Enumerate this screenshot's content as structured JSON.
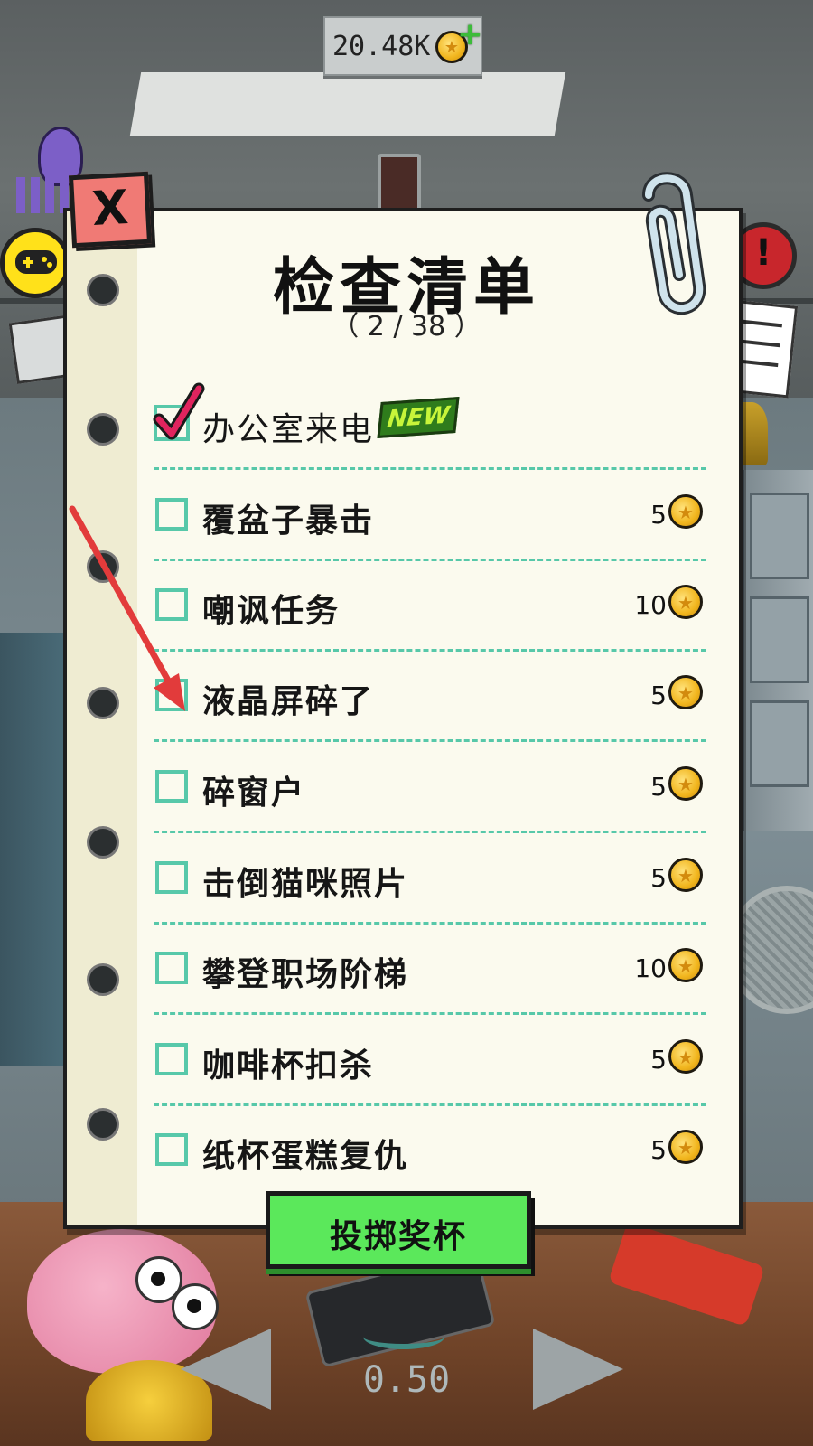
{
  "currency": {
    "amount": "20.48K",
    "coin_icon": "coin-icon",
    "add_icon": "plus-icon"
  },
  "checklist": {
    "close_label": "X",
    "title": "检查清单",
    "progress_text": "（ 2 / 38 ）",
    "items": [
      {
        "label": "办公室来电",
        "checked": true,
        "badge": "NEW",
        "reward": ""
      },
      {
        "label": "覆盆子暴击",
        "checked": false,
        "reward": "5"
      },
      {
        "label": "嘲讽任务",
        "checked": false,
        "reward": "10"
      },
      {
        "label": "液晶屏碎了",
        "checked": false,
        "reward": "5"
      },
      {
        "label": "碎窗户",
        "checked": false,
        "reward": "5"
      },
      {
        "label": "击倒猫咪照片",
        "checked": false,
        "reward": "5"
      },
      {
        "label": "攀登职场阶梯",
        "checked": false,
        "reward": "10"
      },
      {
        "label": "咖啡杯扣杀",
        "checked": false,
        "reward": "5"
      },
      {
        "label": "纸杯蛋糕复仇",
        "checked": false,
        "reward": "5"
      }
    ],
    "throw_button_label": "投掷奖杯"
  },
  "bottom": {
    "throw_value": "0.50"
  },
  "colors": {
    "accent_teal": "#57c8a9",
    "button_green": "#5be85b",
    "close_red": "#f07a75",
    "coin_gold": "#f1b51d"
  }
}
